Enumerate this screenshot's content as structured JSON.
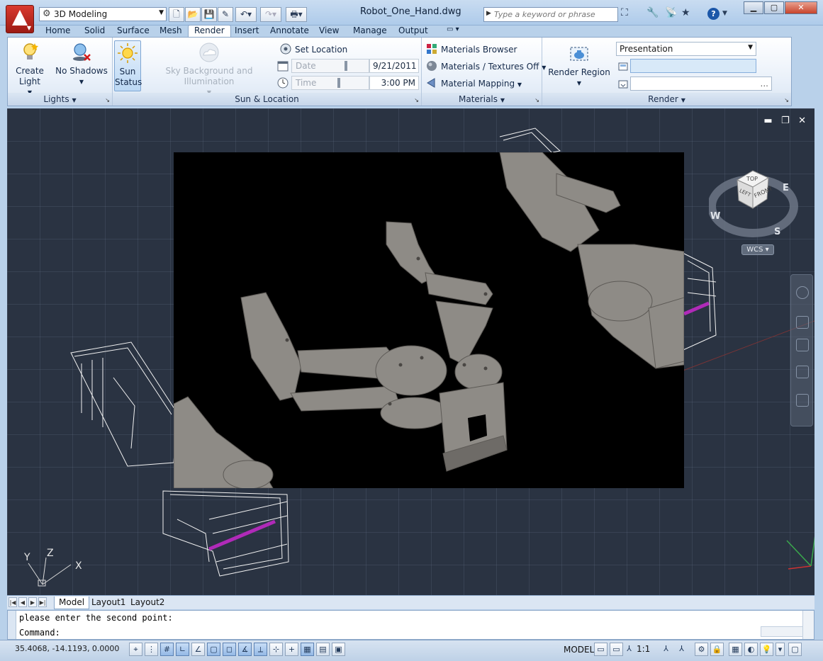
{
  "app": {
    "workspace": "3D Modeling",
    "document_title": "Robot_One_Hand.dwg",
    "search_placeholder": "Type a keyword or phrase",
    "help_label": "?"
  },
  "ribbon_tabs": [
    {
      "label": "Home"
    },
    {
      "label": "Solid"
    },
    {
      "label": "Surface"
    },
    {
      "label": "Mesh"
    },
    {
      "label": "Render",
      "active": true
    },
    {
      "label": "Insert"
    },
    {
      "label": "Annotate"
    },
    {
      "label": "View"
    },
    {
      "label": "Manage"
    },
    {
      "label": "Output"
    }
  ],
  "panels": {
    "lights": {
      "title": "Lights",
      "create_light": "Create Light",
      "no_shadows": "No Shadows"
    },
    "sun_location": {
      "title": "Sun & Location",
      "sun_status": "Sun Status",
      "sky_background": "Sky Background and Illumination",
      "set_location": "Set Location",
      "date_label": "Date",
      "date_value": "9/21/2011",
      "time_label": "Time",
      "time_value": "3:00 PM"
    },
    "materials": {
      "title": "Materials",
      "browser": "Materials Browser",
      "textures": "Materials / Textures Off",
      "mapping": "Material Mapping"
    },
    "render": {
      "title": "Render",
      "render_region": "Render Region",
      "preset": "Presentation",
      "output_value": "",
      "more": "..."
    }
  },
  "viewcube": {
    "top": "TOP",
    "front": "FRONT",
    "left": "LEFT",
    "w": "W",
    "e": "E",
    "s": "S",
    "wcs": "WCS"
  },
  "ucs": {
    "x": "X",
    "y": "Y",
    "z": "Z"
  },
  "layout_tabs": [
    {
      "label": "Model",
      "active": true
    },
    {
      "label": "Layout1"
    },
    {
      "label": "Layout2"
    }
  ],
  "command": {
    "history": "please enter the second point:",
    "prompt": "Command:"
  },
  "status": {
    "coordinates": "35.4068, -14.1193, 0.0000",
    "space": "MODEL",
    "scale": "1:1"
  },
  "colors": {
    "viewport_bg": "#2a3342",
    "render_bg": "#000000",
    "metal": "#8e8b86",
    "wireframe": "#ffffff",
    "highlight": "#b02ab8",
    "title_bar": "#c9dcf1"
  }
}
